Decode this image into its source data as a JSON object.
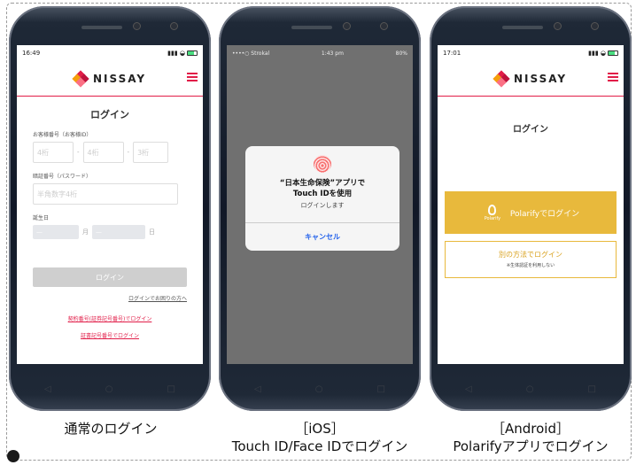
{
  "brand": {
    "name": "NISSAY",
    "accent": "#e11d48",
    "gold": "#e8b93c"
  },
  "phone1": {
    "time": "16:49",
    "title": "ログイン",
    "customer_label": "お客様番号（お客様ID）",
    "customer_fields": [
      "4桁",
      "4桁",
      "3桁"
    ],
    "password_label": "暗証番号（パスワード）",
    "password_placeholder": "半角数字4桁",
    "birth_label": "誕生日",
    "month_suffix": "月",
    "day_suffix": "日",
    "login_button": "ログイン",
    "help_link": "ログインでお困りの方へ",
    "link_contract": "契約番号(証券記号番号)でログイン",
    "link_certificate": "証書記号番号でログイン"
  },
  "phone2": {
    "carrier": "••••○ Strokal",
    "time": "1:43 pm",
    "battery": "80%",
    "dialog_title_1": "“日本生命保険”アプリで",
    "dialog_title_2": "Touch IDを使用",
    "dialog_subtitle": "ログインします",
    "cancel_button": "キャンセル"
  },
  "phone3": {
    "time": "17:01",
    "title": "ログイン",
    "polarify_button": "Polarifyでログイン",
    "polarify_logo_text": "Polarify",
    "alt_button": "別の方法でログイン",
    "alt_note": "※生体認証を利用しない"
  },
  "captions": {
    "c1": "通常のログイン",
    "c2_line1": "［iOS］",
    "c2_line2": "Touch ID/Face IDでログイン",
    "c3_line1": "［Android］",
    "c3_line2": "Polarifyアプリでログイン"
  }
}
